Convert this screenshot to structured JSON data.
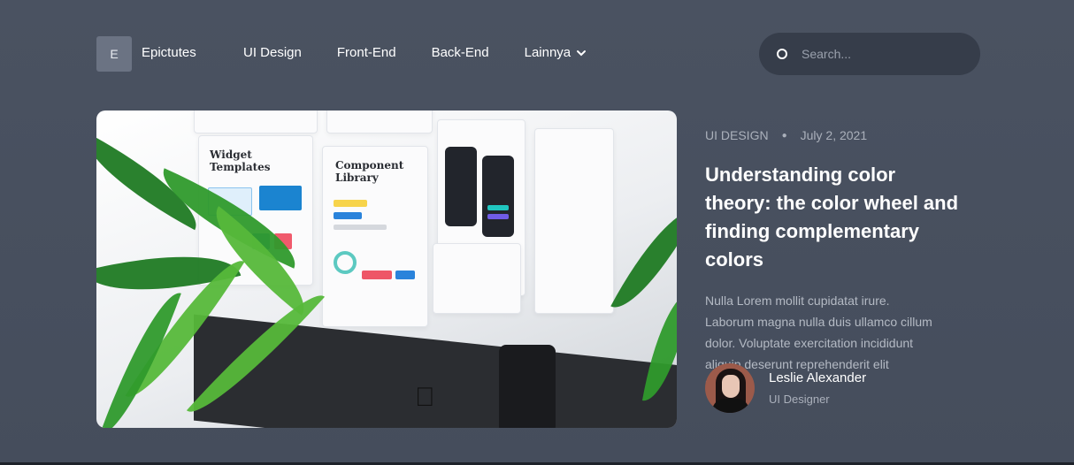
{
  "header": {
    "logo_letter": "E",
    "brand_name": "Epictutes",
    "nav": [
      "UI Design",
      "Front-End",
      "Back-End"
    ],
    "more_label": "Lainnya",
    "search_placeholder": "Search..."
  },
  "hero": {
    "image_card_1": "Widget Templates",
    "image_card_2": "Component Library"
  },
  "article": {
    "category": "UI DESIGN",
    "date": "July 2, 2021",
    "title": "Understanding color theory: the color wheel and finding complementary colors",
    "excerpt": "Nulla Lorem mollit cupidatat irure. Laborum magna nulla duis ullamco cillum dolor. Voluptate exercitation incididunt aliquip deserunt reprehenderit elit laborum.",
    "author": {
      "name": "Leslie Alexander",
      "role": "UI Designer"
    }
  },
  "icons": {
    "search": "search-icon",
    "chevron": "chevron-down-icon"
  },
  "colors": {
    "background": "#4a5261",
    "search_bg": "#363d4a",
    "logo_bg": "#6b7383"
  }
}
